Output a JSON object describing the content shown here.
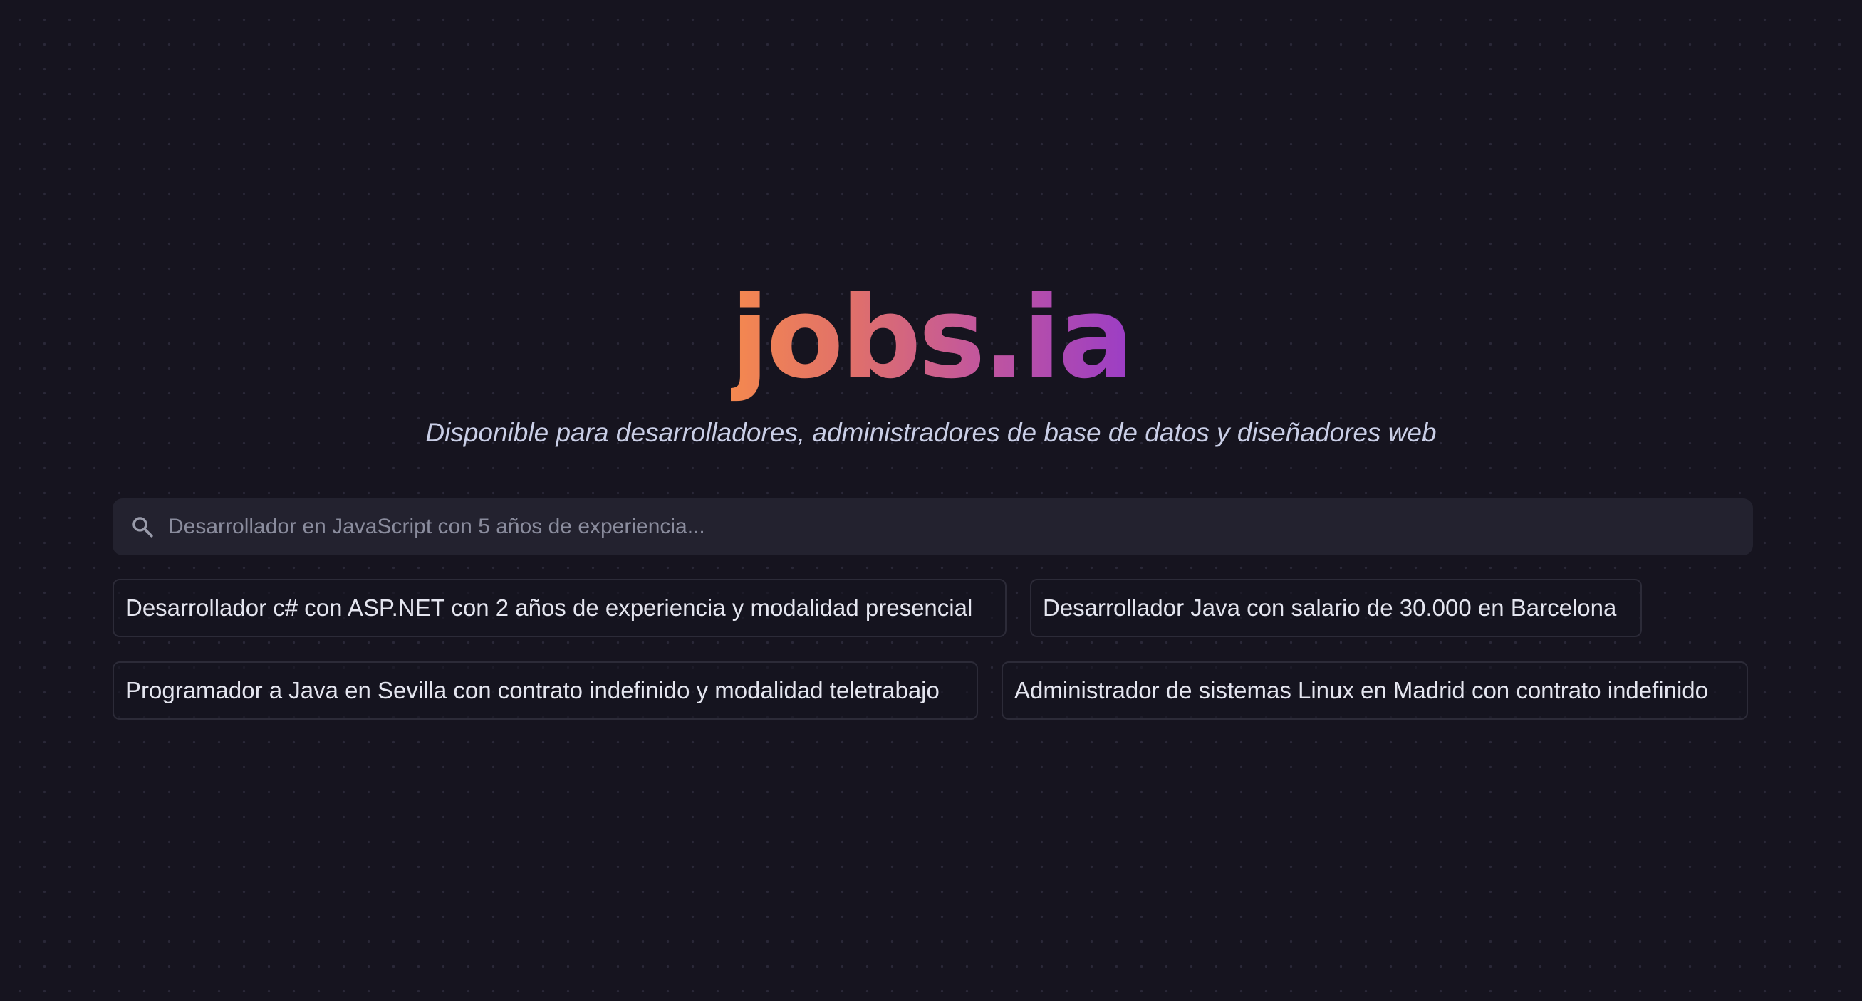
{
  "brand": {
    "logo_text": "jobs.ia",
    "gradient_colors": [
      "#f4884f",
      "#e0706a",
      "#c4589a",
      "#9b3dc6"
    ]
  },
  "tagline": "Disponible para desarrolladores, administradores de base de datos y diseñadores web",
  "search": {
    "icon": "search-icon",
    "placeholder": "Desarrollador en JavaScript con 5 años de experiencia...",
    "value": ""
  },
  "suggestions": [
    {
      "label": "Desarrollador c# con ASP.NET con 2 años de experiencia y modalidad presencial"
    },
    {
      "label": "Desarrollador Java con salario de 30.000 en Barcelona"
    },
    {
      "label": "Programador a Java en Sevilla con contrato indefinido y modalidad teletrabajo"
    },
    {
      "label": "Administrador de sistemas Linux en Madrid con contrato indefinido"
    }
  ],
  "colors": {
    "background": "#16141f",
    "search_background": "#23222f",
    "chip_border": "#2c2b38",
    "text": "#e4e5ef",
    "tagline": "#c9cee6"
  }
}
